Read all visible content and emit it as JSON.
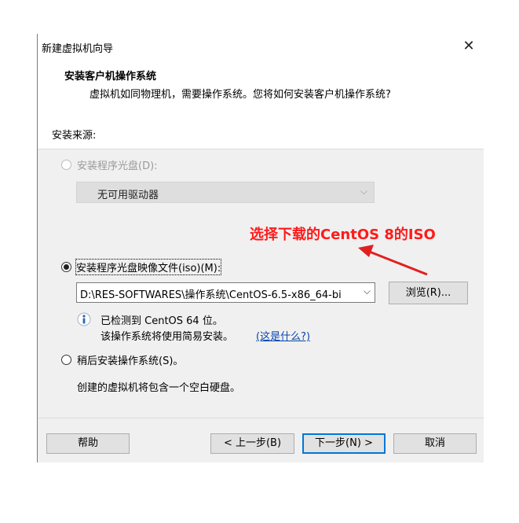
{
  "window": {
    "title": "新建虚拟机向导",
    "close_glyph": "✕"
  },
  "header": {
    "title": "安装客户机操作系统",
    "subtitle": "虚拟机如同物理机，需要操作系统。您将如何安装客户机操作系统?"
  },
  "source": {
    "label": "安装来源:",
    "disc_option": {
      "label": "安装程序光盘(D):",
      "enabled": false,
      "selected": false
    },
    "disc_drive_select": {
      "value": "无可用驱动器",
      "enabled": false
    },
    "iso_option": {
      "label": "安装程序光盘映像文件(iso)(M):",
      "selected": true
    },
    "iso_path": "D:\\RES-SOFTWARES\\操作系统\\CentOS-6.5-x86_64-bi",
    "browse_label": "浏览(R)...",
    "detected_text": "已检测到 CentOS 64 位。",
    "easy_install_text": "该操作系统将使用简易安装。",
    "whats_this_link": "(这是什么?)",
    "later_option": {
      "label": "稍后安装操作系统(S)。",
      "selected": false
    },
    "later_desc": "创建的虚拟机将包含一个空白硬盘。"
  },
  "buttons": {
    "help": "帮助",
    "back": "< 上一步(B)",
    "next": "下一步(N) >",
    "cancel": "取消"
  },
  "annotation": {
    "text": "选择下载的CentOS 8的ISO",
    "color": "#ff1a1a"
  },
  "colors": {
    "link": "#0645ad",
    "default_button_border": "#0078d7",
    "dialog_bg": "#f0f0f0"
  }
}
